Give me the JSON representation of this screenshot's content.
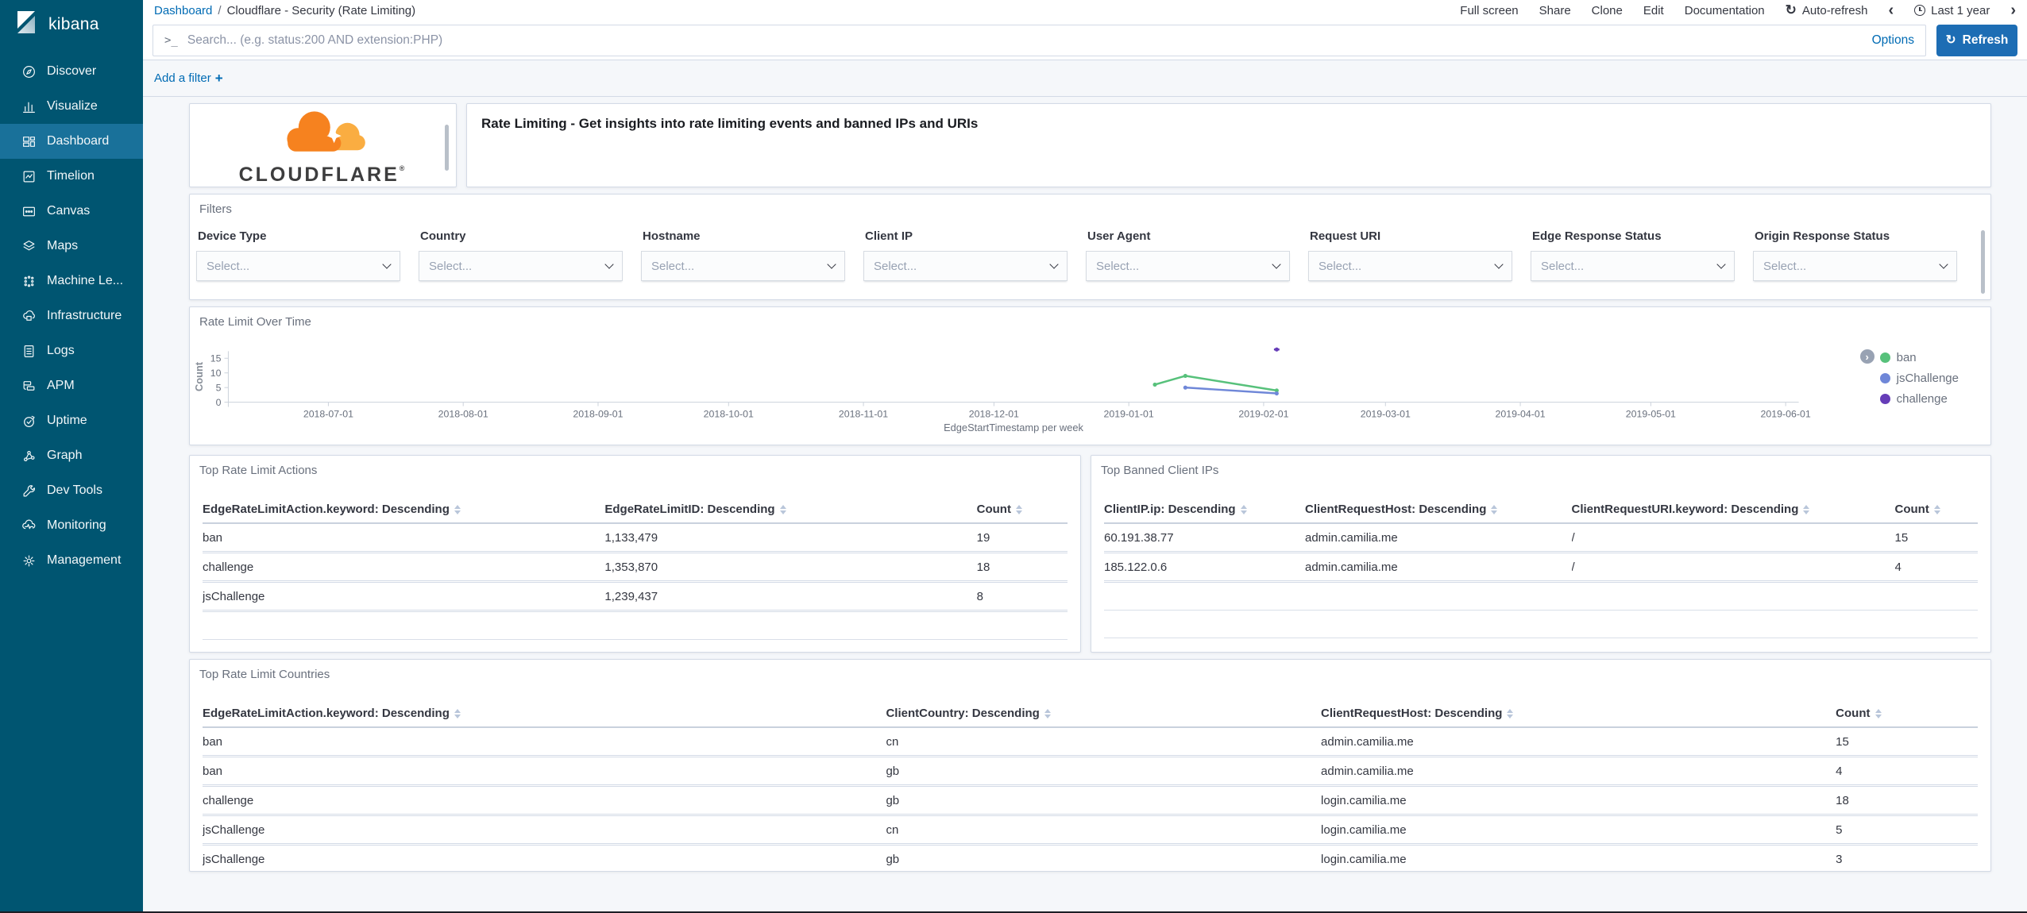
{
  "colors": {
    "accent_blue": "#006bb4",
    "sidebar_bg": "#005571",
    "sidebar_active_bg": "#19719a",
    "refresh_button": "#1d6db4",
    "cloudflare_orange": "#f6821f",
    "cloudflare_light_orange": "#faad41"
  },
  "icons": {
    "search_prompt": ">_",
    "auto_refresh": "↻",
    "refresh": "↻",
    "time_prev": "‹",
    "time_next": "›",
    "add_filter_plus": "+",
    "legend_expand": "›"
  },
  "sidebar": {
    "logo_text": "kibana",
    "items": [
      {
        "label": "Discover",
        "icon": "discover",
        "active": false
      },
      {
        "label": "Visualize",
        "icon": "visualize",
        "active": false
      },
      {
        "label": "Dashboard",
        "icon": "dashboard",
        "active": true
      },
      {
        "label": "Timelion",
        "icon": "timelion",
        "active": false
      },
      {
        "label": "Canvas",
        "icon": "canvas",
        "active": false
      },
      {
        "label": "Maps",
        "icon": "maps",
        "active": false
      },
      {
        "label": "Machine Le...",
        "icon": "machine-learning",
        "active": false
      },
      {
        "label": "Infrastructure",
        "icon": "infrastructure",
        "active": false
      },
      {
        "label": "Logs",
        "icon": "logs",
        "active": false
      },
      {
        "label": "APM",
        "icon": "apm",
        "active": false
      },
      {
        "label": "Uptime",
        "icon": "uptime",
        "active": false
      },
      {
        "label": "Graph",
        "icon": "graph",
        "active": false
      },
      {
        "label": "Dev Tools",
        "icon": "dev-tools",
        "active": false
      },
      {
        "label": "Monitoring",
        "icon": "monitoring",
        "active": false
      },
      {
        "label": "Management",
        "icon": "management",
        "active": false
      }
    ]
  },
  "topbar": {
    "breadcrumb": {
      "root": "Dashboard",
      "separator": "/",
      "current": "Cloudflare - Security (Rate Limiting)"
    },
    "menu": [
      "Full screen",
      "Share",
      "Clone",
      "Edit",
      "Documentation"
    ],
    "auto_refresh_label": "Auto-refresh",
    "time_range": "Last 1 year"
  },
  "query_bar": {
    "placeholder": "Search... (e.g. status:200 AND extension:PHP)",
    "options_label": "Options",
    "refresh_label": "Refresh"
  },
  "filter_bar": {
    "add_filter_label": "Add a filter"
  },
  "panels": {
    "logo": {
      "brand": "CLOUDFLARE",
      "brand_mark": "®"
    },
    "description": {
      "text": "Rate Limiting - Get insights into rate limiting events and banned IPs and URIs"
    },
    "filters": {
      "title": "Filters",
      "placeholder": "Select...",
      "fields": [
        "Device Type",
        "Country",
        "Hostname",
        "Client IP",
        "User Agent",
        "Request URI",
        "Edge Response Status",
        "Origin Response Status"
      ]
    },
    "actions_table": {
      "title": "Top Rate Limit Actions",
      "columns": [
        "EdgeRateLimitAction.keyword: Descending",
        "EdgeRateLimitID: Descending",
        "Count"
      ],
      "rows": [
        [
          "ban",
          "1,133,479",
          "19"
        ],
        [
          "challenge",
          "1,353,870",
          "18"
        ],
        [
          "jsChallenge",
          "1,239,437",
          "8"
        ]
      ]
    },
    "banned_ips_table": {
      "title": "Top Banned Client IPs",
      "columns": [
        "ClientIP.ip: Descending",
        "ClientRequestHost: Descending",
        "ClientRequestURI.keyword: Descending",
        "Count"
      ],
      "rows": [
        [
          "60.191.38.77",
          "admin.camilia.me",
          "/",
          "15"
        ],
        [
          "185.122.0.6",
          "admin.camilia.me",
          "/",
          "4"
        ]
      ]
    },
    "countries_table": {
      "title": "Top Rate Limit Countries",
      "columns": [
        "EdgeRateLimitAction.keyword: Descending",
        "ClientCountry: Descending",
        "ClientRequestHost: Descending",
        "Count"
      ],
      "rows": [
        [
          "ban",
          "cn",
          "admin.camilia.me",
          "15"
        ],
        [
          "ban",
          "gb",
          "admin.camilia.me",
          "4"
        ],
        [
          "challenge",
          "gb",
          "login.camilia.me",
          "18"
        ],
        [
          "jsChallenge",
          "cn",
          "login.camilia.me",
          "5"
        ],
        [
          "jsChallenge",
          "gb",
          "login.camilia.me",
          "3"
        ]
      ]
    }
  },
  "chart_data": {
    "type": "line",
    "title": "Rate Limit Over Time",
    "xlabel": "EdgeStartTimestamp per week",
    "ylabel": "Count",
    "x_domain": [
      "2018-06-08",
      "2019-06-04"
    ],
    "ylim": [
      0,
      19
    ],
    "y_ticks": [
      0,
      5,
      10,
      15
    ],
    "x_ticks": [
      "2018-07-01",
      "2018-08-01",
      "2018-09-01",
      "2018-10-01",
      "2018-11-01",
      "2018-12-01",
      "2019-01-01",
      "2019-02-01",
      "2019-03-01",
      "2019-04-01",
      "2019-05-01",
      "2019-06-01"
    ],
    "grid": false,
    "legend_position": "right",
    "series": [
      {
        "name": "ban",
        "color": "#57c17b",
        "points": [
          {
            "x": "2019-01-07",
            "y": 6
          },
          {
            "x": "2019-01-14",
            "y": 9
          },
          {
            "x": "2019-02-04",
            "y": 4
          }
        ]
      },
      {
        "name": "jsChallenge",
        "color": "#6f87d8",
        "points": [
          {
            "x": "2019-01-14",
            "y": 5
          },
          {
            "x": "2019-02-04",
            "y": 3
          }
        ]
      },
      {
        "name": "challenge",
        "color": "#663db8",
        "points": [
          {
            "x": "2019-02-04",
            "y": 18
          }
        ]
      }
    ]
  }
}
